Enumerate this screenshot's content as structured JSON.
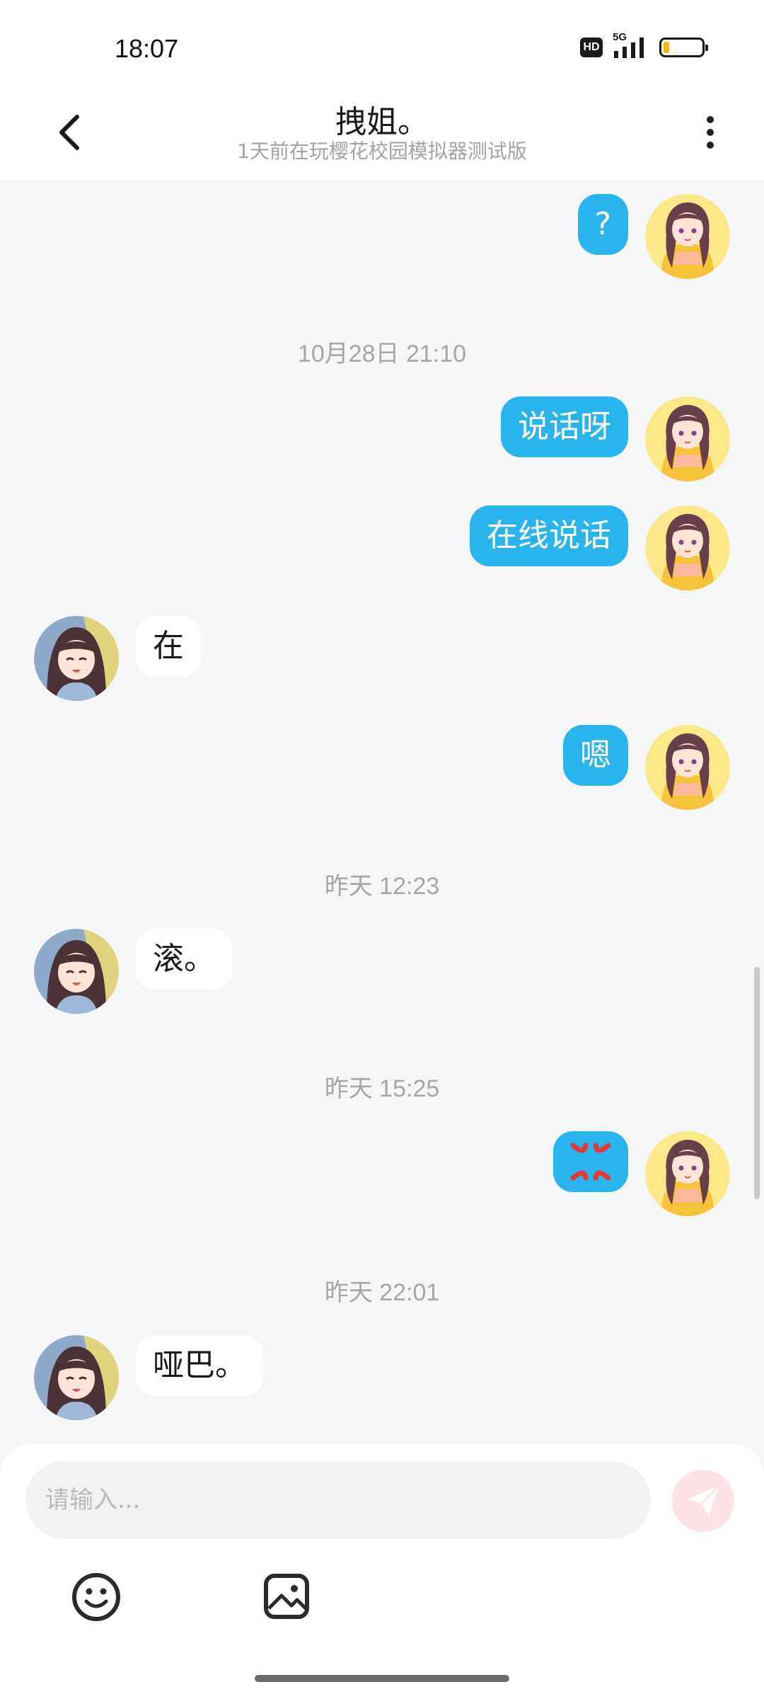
{
  "status_bar": {
    "time": "18:07",
    "hd_label": "HD",
    "network_label": "5G",
    "battery_color": "#f5b800"
  },
  "header": {
    "title": "拽姐。",
    "subtitle": "1天前在玩樱花校园模拟器测试版",
    "back_icon": "chevron-left-icon",
    "more_icon": "more-vertical-icon"
  },
  "messages": [
    {
      "sender": "me",
      "text": "?"
    },
    {
      "timestamp": "10月28日 21:10"
    },
    {
      "sender": "me",
      "text": "说话呀"
    },
    {
      "sender": "me",
      "text": "在线说话"
    },
    {
      "sender": "other",
      "text": "在"
    },
    {
      "sender": "me",
      "text": "嗯"
    },
    {
      "timestamp": "昨天 12:23"
    },
    {
      "sender": "other",
      "text": "滚。"
    },
    {
      "timestamp": "昨天 15:25"
    },
    {
      "sender": "me",
      "emoji": "anger-symbol-icon"
    },
    {
      "timestamp": "昨天 22:01"
    },
    {
      "sender": "other",
      "text": "哑巴。"
    }
  ],
  "chat": {
    "t1": "10月28日 21:10",
    "t2": "昨天 12:23",
    "t3": "昨天 15:25",
    "t4": "昨天 22:01",
    "m1": "?",
    "m2": "说话呀",
    "m3": "在线说话",
    "m4": "在",
    "m5": "嗯",
    "m6": "滚。",
    "m8": "哑巴。"
  },
  "input": {
    "placeholder": "请输入...",
    "send_icon": "paper-plane-icon",
    "emoji_icon": "smiley-icon",
    "image_icon": "image-icon"
  },
  "colors": {
    "my_bubble": "#2ab4ee",
    "other_bubble": "#ffffff",
    "background": "#f4f6f8",
    "send_button_bg": "#fde3e5",
    "send_icon": "#f7b9bd",
    "anger_emoji": "#e53935"
  }
}
